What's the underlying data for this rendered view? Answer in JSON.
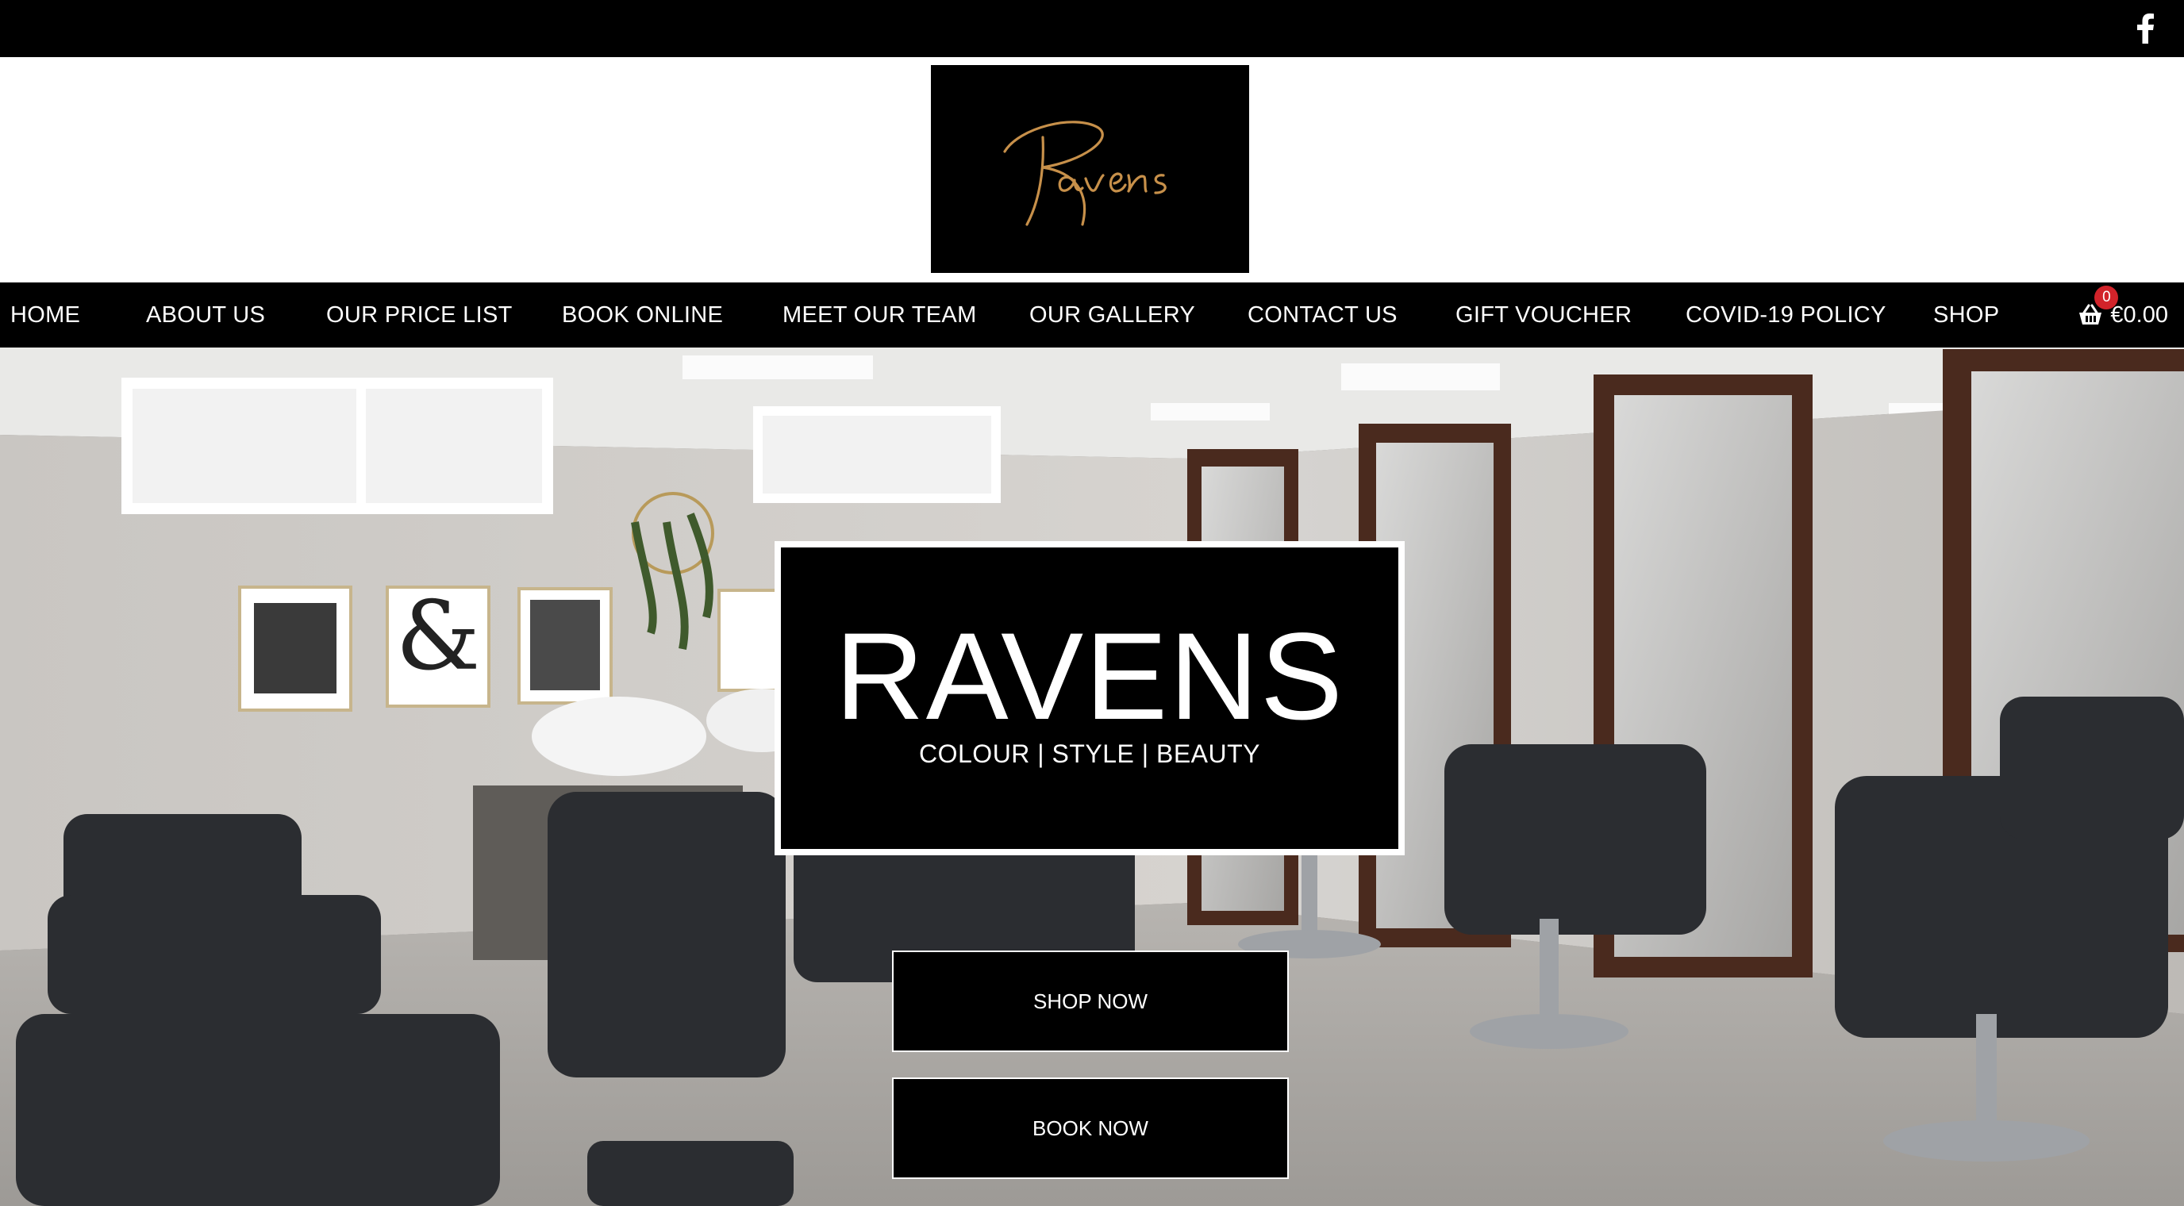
{
  "brand": {
    "logo_text": "Ravens",
    "logo_color": "#c7904a"
  },
  "social": {
    "icon": "facebook-icon"
  },
  "nav": {
    "items": [
      {
        "label": "HOME"
      },
      {
        "label": "ABOUT US"
      },
      {
        "label": "OUR PRICE LIST"
      },
      {
        "label": "BOOK ONLINE"
      },
      {
        "label": "MEET OUR TEAM"
      },
      {
        "label": "OUR GALLERY"
      },
      {
        "label": "CONTACT US"
      },
      {
        "label": "GIFT VOUCHER"
      },
      {
        "label": "COVID-19 POLICY"
      },
      {
        "label": "SHOP"
      }
    ],
    "cart": {
      "icon": "basket-icon",
      "count": "0",
      "total": "€0.00",
      "badge_color": "#d2232a"
    }
  },
  "hero": {
    "title": "RAVENS",
    "subtitle": "COLOUR | STYLE | BEAUTY",
    "shop_label": "SHOP NOW",
    "book_label": "BOOK NOW"
  }
}
